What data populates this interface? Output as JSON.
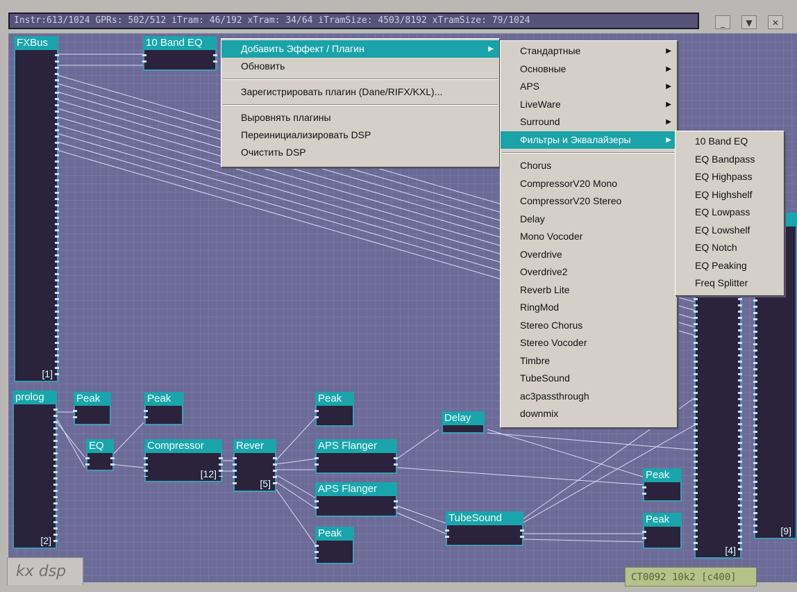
{
  "window": {
    "title": "Instr:613/1024 GPRs: 502/512 iTram: 46/192 xTram: 34/64 iTramSize: 4503/8192 xTramSize: 79/1024",
    "buttons": [
      "_",
      "▼",
      "✕"
    ]
  },
  "plugins": {
    "fxbus": {
      "label": "FXBus",
      "number": "[1]"
    },
    "eq10": {
      "label": "10 Band EQ"
    },
    "prolog": {
      "label": "prolog",
      "number": "[2]"
    },
    "peak1": {
      "label": "Peak"
    },
    "peak2": {
      "label": "Peak"
    },
    "eq": {
      "label": "EQ"
    },
    "compressor": {
      "label": "Compressor",
      "number": "[12]"
    },
    "reverb": {
      "label": "Rever",
      "number": "[5]"
    },
    "peak3": {
      "label": "Peak"
    },
    "aps1": {
      "label": "APS Flanger"
    },
    "aps2": {
      "label": "APS Flanger"
    },
    "peak4": {
      "label": "Peak"
    },
    "delay": {
      "label": "Delay"
    },
    "tubesound": {
      "label": "TubeSound"
    },
    "peak5": {
      "label": "Peak"
    },
    "peak6": {
      "label": "Peak"
    },
    "out4": {
      "number": "[4]"
    },
    "out9": {
      "number": "[9]"
    }
  },
  "context_menu": {
    "items": [
      "Добавить Эффект / Плагин",
      "Обновить",
      "Зарегистрировать плагин (Dane/RIFX/KXL)...",
      "Выровнять плагины",
      "Переинициализировать DSP",
      "Очистить DSP"
    ]
  },
  "submenu_categories": {
    "items": [
      "Стандартные",
      "Основные",
      "APS",
      "LiveWare",
      "Surround",
      "Фильтры и Эквалайзеры"
    ],
    "effects": [
      "Chorus",
      "CompressorV20 Mono",
      "CompressorV20 Stereo",
      "Delay",
      "Mono Vocoder",
      "Overdrive",
      "Overdrive2",
      "Reverb Lite",
      "RingMod",
      "Stereo Chorus",
      "Stereo Vocoder",
      "Timbre",
      "TubeSound",
      "ac3passthrough",
      "downmix"
    ]
  },
  "submenu_filters": {
    "items": [
      "10 Band EQ",
      "EQ Bandpass",
      "EQ Highpass",
      "EQ Highshelf",
      "EQ Lowpass",
      "EQ Lowshelf",
      "EQ Notch",
      "EQ Peaking",
      "Freq Splitter"
    ]
  },
  "footer": {
    "app_label": "kx dsp",
    "status": "CT0092 10k2 [c400]"
  }
}
